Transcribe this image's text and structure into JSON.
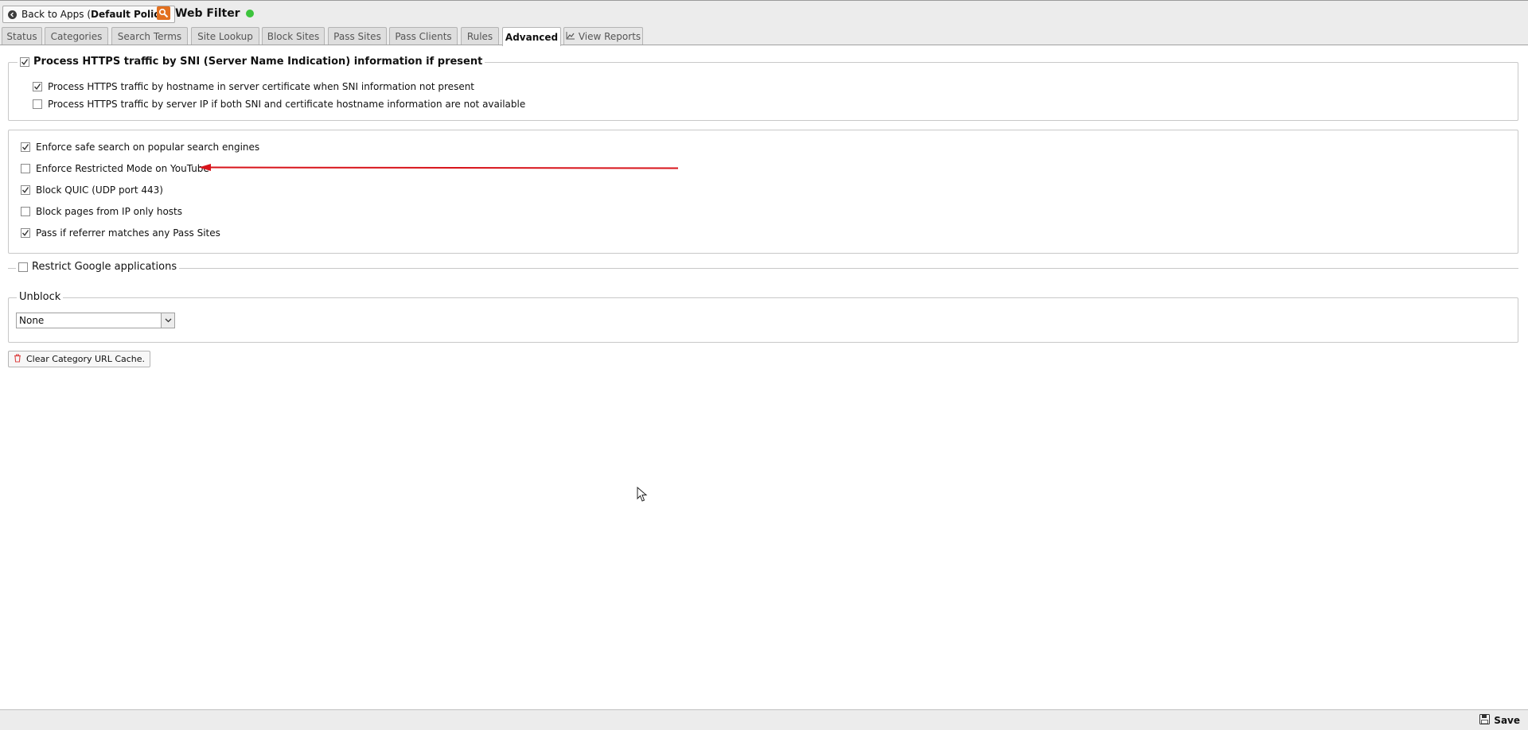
{
  "header": {
    "back_label_prefix": "Back to Apps (",
    "back_label_policy": "Default Policy",
    "back_label_suffix": ")",
    "app_title": "Web Filter",
    "status_color": "#3cc43c"
  },
  "tabs": [
    {
      "label": "Status"
    },
    {
      "label": "Categories"
    },
    {
      "label": "Search Terms"
    },
    {
      "label": "Site Lookup"
    },
    {
      "label": "Block Sites"
    },
    {
      "label": "Pass Sites"
    },
    {
      "label": "Pass Clients"
    },
    {
      "label": "Rules"
    },
    {
      "label": "Advanced",
      "active": true
    },
    {
      "label": "View Reports",
      "icon": "chart-icon"
    }
  ],
  "sni": {
    "legend": "Process HTTPS traffic by SNI (Server Name Indication) information if present",
    "checked": true,
    "options": [
      {
        "label": "Process HTTPS traffic by hostname in server certificate when SNI information not present",
        "checked": true
      },
      {
        "label": "Process HTTPS traffic by server IP if both SNI and certificate hostname information are not available",
        "checked": false
      }
    ]
  },
  "options": [
    {
      "label": "Enforce safe search on popular search engines",
      "checked": true
    },
    {
      "label": "Enforce Restricted Mode on YouTube",
      "checked": false
    },
    {
      "label": "Block QUIC (UDP port 443)",
      "checked": true
    },
    {
      "label": "Block pages from IP only hosts",
      "checked": false
    },
    {
      "label": "Pass if referrer matches any Pass Sites",
      "checked": true
    }
  ],
  "google": {
    "legend": "Restrict Google applications",
    "checked": false
  },
  "unblock": {
    "legend": "Unblock",
    "selected": "None"
  },
  "clear_cache_label": "Clear Category URL Cache.",
  "footer": {
    "save_label": "Save"
  },
  "annotation_color": "#d8141b"
}
